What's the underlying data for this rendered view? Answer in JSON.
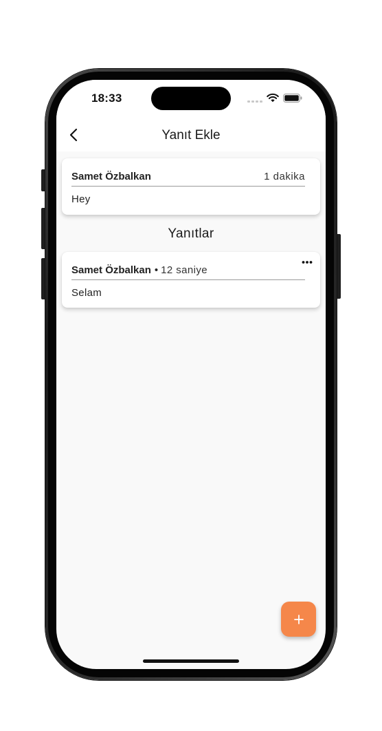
{
  "status_bar": {
    "time": "18:33",
    "icons": [
      "signal-dots-icon",
      "wifi-icon",
      "battery-icon"
    ]
  },
  "app_bar": {
    "back_icon": "chevron-left-icon",
    "title": "Yanıt Ekle"
  },
  "comment": {
    "author": "Samet Özbalkan",
    "time": "1 dakika",
    "text": "Hey"
  },
  "replies_section": {
    "title": "Yanıtlar"
  },
  "replies": [
    {
      "author": "Samet Özbalkan",
      "separator": "•",
      "time": "12 saniye",
      "text": "Selam",
      "menu_icon": "more-horizontal-icon"
    }
  ],
  "fab": {
    "icon": "plus-icon"
  },
  "colors": {
    "accent": "#f5874a",
    "screen_background": "#f9f9f9",
    "card_background": "#ffffff",
    "divider": "#9a9a9a",
    "text_primary": "#222222"
  }
}
